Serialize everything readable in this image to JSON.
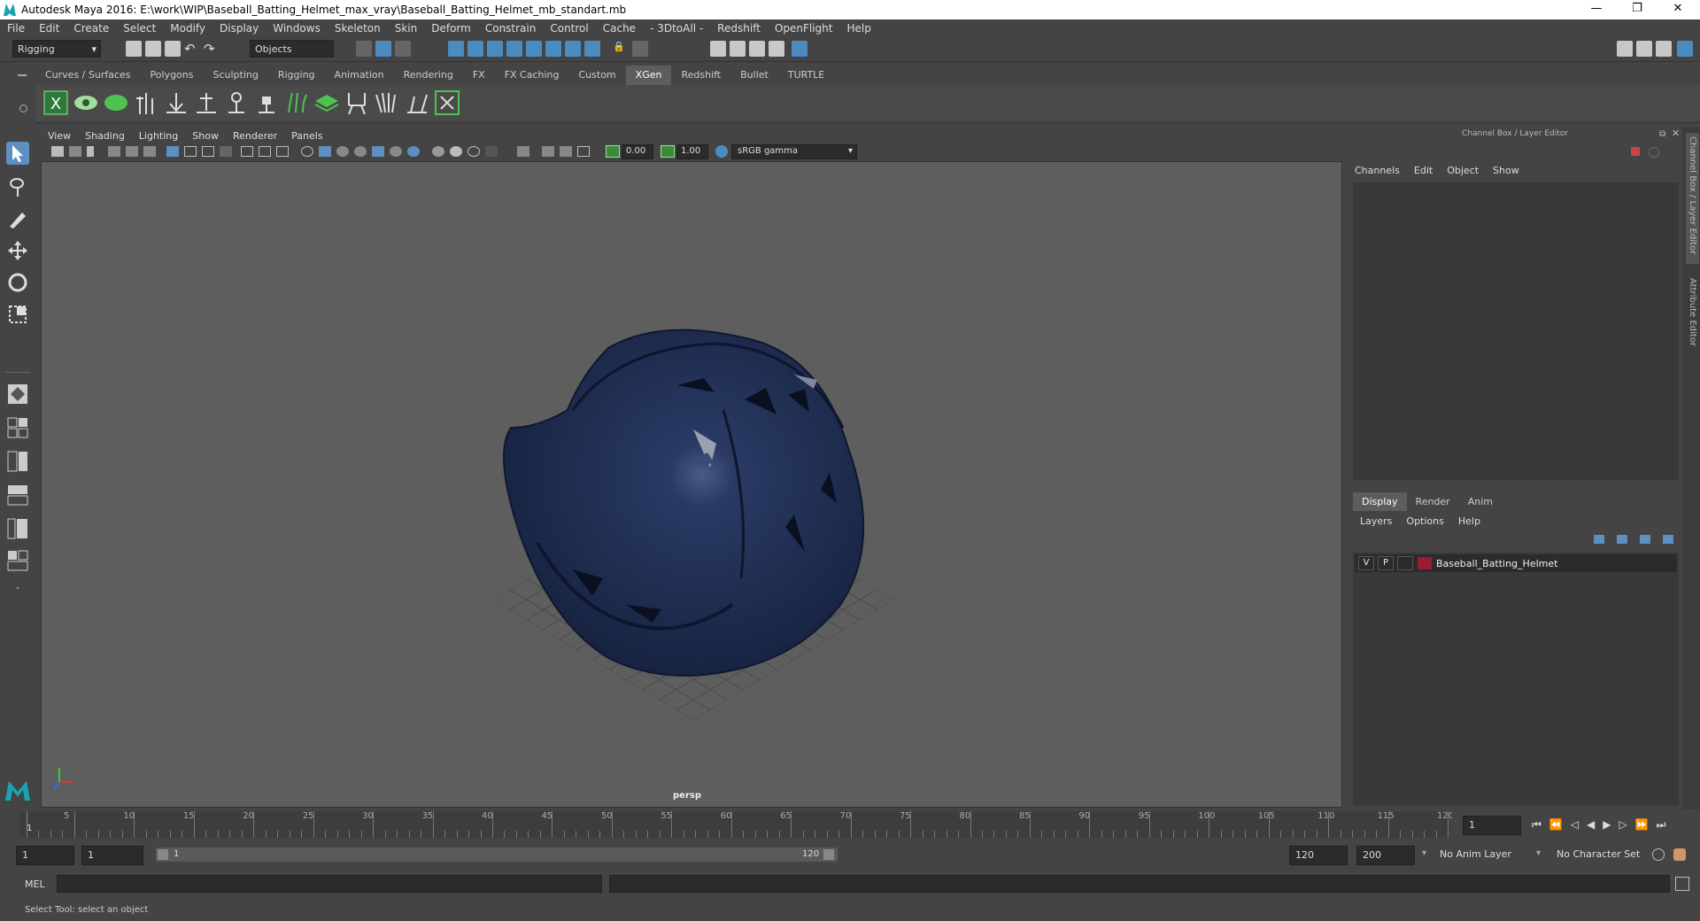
{
  "window": {
    "title": "Autodesk Maya 2016: E:\\work\\WIP\\Baseball_Batting_Helmet_max_vray\\Baseball_Batting_Helmet_mb_standart.mb",
    "minimize": "—",
    "restore": "❐",
    "close": "✕"
  },
  "menu": [
    "File",
    "Edit",
    "Create",
    "Select",
    "Modify",
    "Display",
    "Windows",
    "Skeleton",
    "Skin",
    "Deform",
    "Constrain",
    "Control",
    "Cache",
    "- 3DtoAll -",
    "Redshift",
    "OpenFlight",
    "Help"
  ],
  "statusline": {
    "mode": "Rigging",
    "selection_mode": "Objects"
  },
  "shelf": {
    "tabs": [
      "Curves / Surfaces",
      "Polygons",
      "Sculpting",
      "Rigging",
      "Animation",
      "Rendering",
      "FX",
      "FX Caching",
      "Custom",
      "XGen",
      "Redshift",
      "Bullet",
      "TURTLE"
    ],
    "active_tab": "XGen"
  },
  "viewport": {
    "menu": [
      "View",
      "Shading",
      "Lighting",
      "Show",
      "Renderer",
      "Panels"
    ],
    "exposure": "0.00",
    "gamma": "1.00",
    "color_space": "sRGB gamma",
    "camera": "persp"
  },
  "channel_box": {
    "title": "Channel Box / Layer Editor",
    "menu": [
      "Channels",
      "Edit",
      "Object",
      "Show"
    ],
    "layer_tabs": [
      "Display",
      "Render",
      "Anim"
    ],
    "active_layer_tab": "Display",
    "layer_menu": [
      "Layers",
      "Options",
      "Help"
    ],
    "layers": [
      {
        "v": "V",
        "p": "P",
        "color": "#9b1b30",
        "name": "Baseball_Batting_Helmet"
      }
    ],
    "side_tabs": [
      "Channel Box / Layer Editor",
      "Attribute Editor"
    ]
  },
  "timeline": {
    "ticks": [
      "5",
      "10",
      "15",
      "20",
      "25",
      "30",
      "35",
      "40",
      "45",
      "50",
      "55",
      "60",
      "65",
      "70",
      "75",
      "80",
      "85",
      "90",
      "95",
      "100",
      "105",
      "110",
      "115",
      "120"
    ],
    "current_frame": "1",
    "current_frame_field": "1"
  },
  "range": {
    "start": "1",
    "start_inner": "1",
    "range_start_label": "1",
    "range_end_label": "120",
    "end_inner": "120",
    "end": "200",
    "anim_layer": "No Anim Layer",
    "character_set": "No Character Set"
  },
  "command": {
    "label": "MEL"
  },
  "help_line": "Select Tool: select an object",
  "colors": {
    "accent": "#4b8cc0",
    "helmet": "#1f2d52",
    "layer": "#9b1b30"
  }
}
